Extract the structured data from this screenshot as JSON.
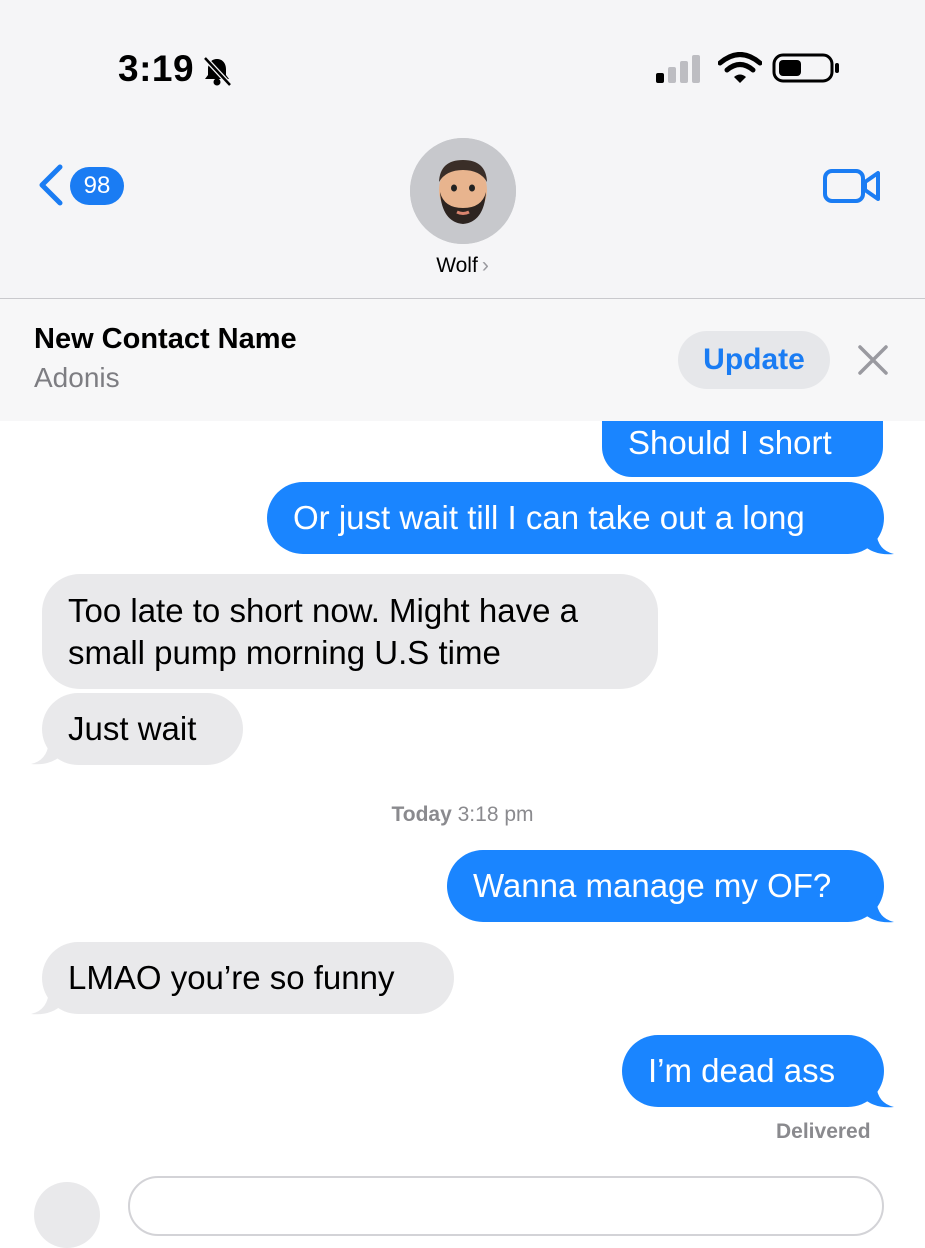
{
  "status_bar": {
    "time": "3:19"
  },
  "header": {
    "back_badge": "98",
    "contact_name": "Wolf",
    "contact_chevron": "›"
  },
  "banner": {
    "title": "New Contact Name",
    "subtitle": "Adonis",
    "update_label": "Update"
  },
  "messages": [
    {
      "direction": "out",
      "text": "Should I short"
    },
    {
      "direction": "out",
      "text": "Or just wait till I can take out a long"
    },
    {
      "direction": "in",
      "lines": [
        "Too late to short now. Might have a",
        "small pump morning U.S time"
      ]
    },
    {
      "direction": "in",
      "text": "Just wait"
    },
    {
      "direction": "out",
      "text": "Wanna manage my OF?"
    },
    {
      "direction": "in",
      "text": "LMAO you’re so funny"
    },
    {
      "direction": "out",
      "text": "I’m dead ass"
    }
  ],
  "timestamp": {
    "day": "Today",
    "time": "3:18 pm"
  },
  "delivered": "Delivered",
  "colors": {
    "accent": "#1a7cf3",
    "outgoing_bubble": "#1a85ff",
    "incoming_bubble": "#e9e9eb"
  },
  "icons": [
    "bell-slash-icon",
    "cellular-signal-icon",
    "wifi-icon",
    "battery-icon",
    "chevron-left-icon",
    "video-camera-icon",
    "close-icon"
  ]
}
